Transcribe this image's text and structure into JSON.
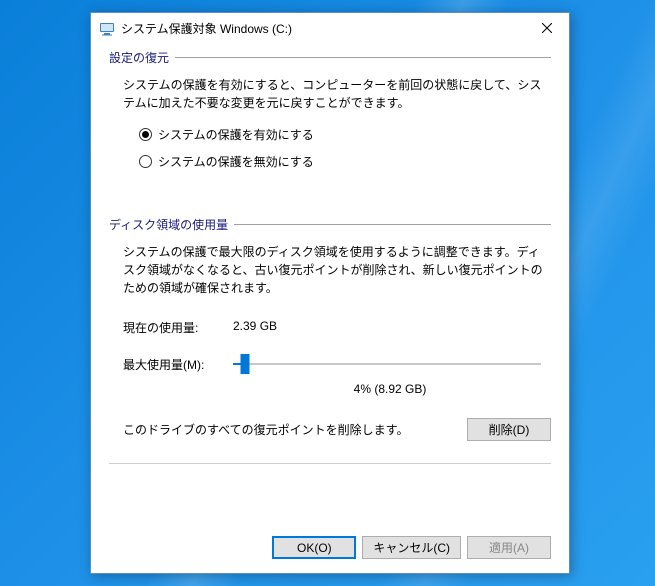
{
  "window": {
    "title": "システム保護対象 Windows (C:)"
  },
  "section_restore": {
    "header": "設定の復元",
    "desc": "システムの保護を有効にすると、コンピューターを前回の状態に戻して、システムに加えた不要な変更を元に戻すことができます。",
    "radio_enable": "システムの保護を有効にする",
    "radio_disable": "システムの保護を無効にする",
    "selected": "enable"
  },
  "section_disk": {
    "header": "ディスク領域の使用量",
    "desc": "システムの保護で最大限のディスク領域を使用するように調整できます。ディスク領域がなくなると、古い復元ポイントが削除され、新しい復元ポイントのための領域が確保されます。",
    "current_label": "現在の使用量:",
    "current_value": "2.39 GB",
    "max_label": "最大使用量(M):",
    "slider_percent": 4,
    "slider_text": "4% (8.92 GB)"
  },
  "delete": {
    "text": "このドライブのすべての復元ポイントを削除します。",
    "button": "削除(D)"
  },
  "buttons": {
    "ok": "OK(O)",
    "cancel": "キャンセル(C)",
    "apply": "適用(A)"
  }
}
